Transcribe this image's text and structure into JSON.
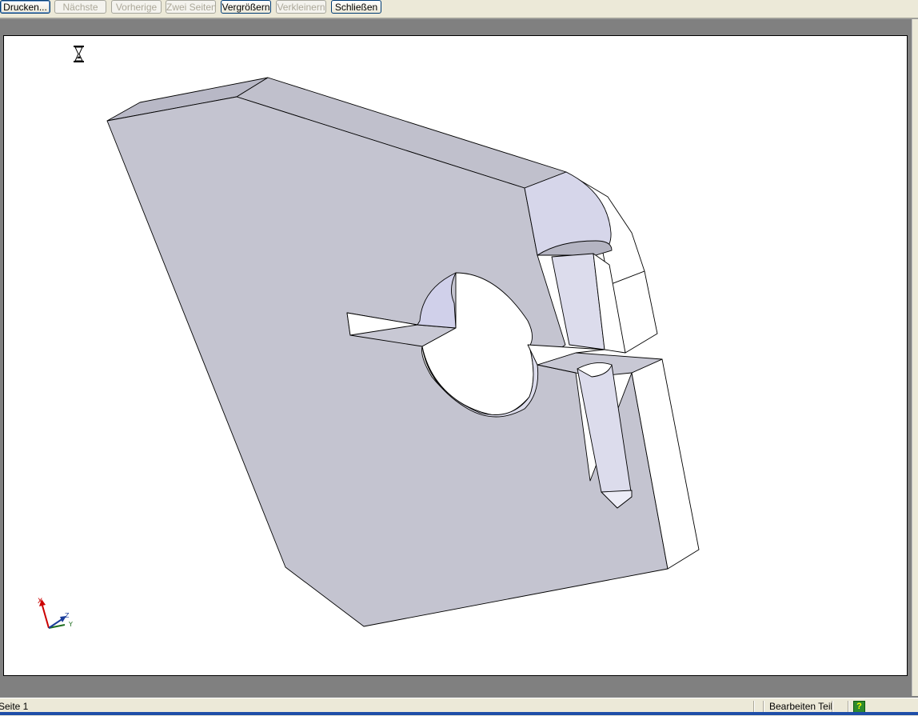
{
  "toolbar": {
    "buttons": [
      {
        "label": "Drucken...",
        "enabled": true
      },
      {
        "label": "Nächste",
        "enabled": false
      },
      {
        "label": "Vorherige",
        "enabled": false
      },
      {
        "label": "Zwei Seiten",
        "enabled": false
      },
      {
        "label": "Vergrößern",
        "enabled": true
      },
      {
        "label": "Verkleinern",
        "enabled": false
      },
      {
        "label": "Schließen",
        "enabled": true
      }
    ]
  },
  "preview": {
    "busy_icon": "hourglass-icon",
    "triad": {
      "x_label": "X",
      "z_label": "Z",
      "y_label": "Y"
    }
  },
  "statusbar": {
    "page": "Seite 1",
    "mode": "Bearbeiten Teil",
    "help_icon": "help-icon"
  },
  "colors": {
    "face_main": "#c4c4d0",
    "face_side": "#ffffff",
    "window_bg": "#808080",
    "chrome": "#ece9d8"
  }
}
